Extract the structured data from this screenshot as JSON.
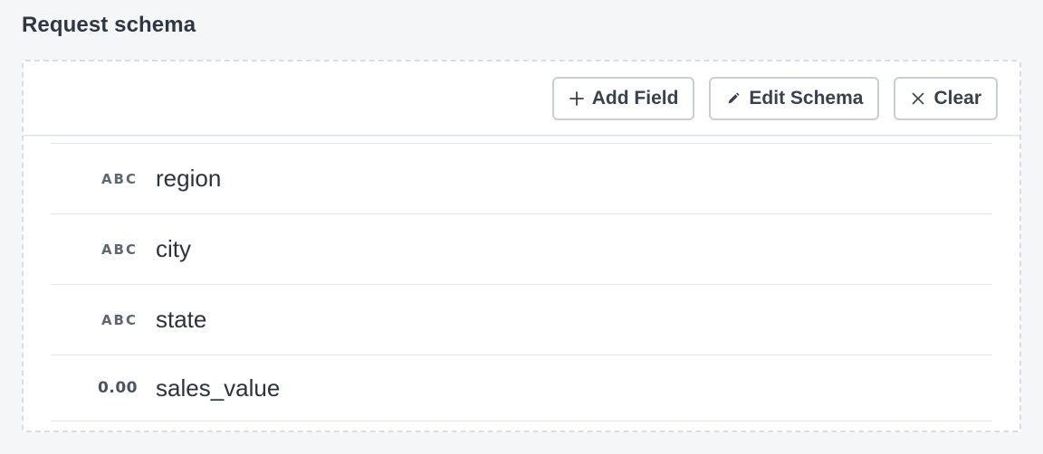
{
  "section": {
    "title": "Request schema"
  },
  "toolbar": {
    "add_field": {
      "label": "Add Field",
      "icon": "plus-icon"
    },
    "edit_schema": {
      "label": "Edit Schema",
      "icon": "pencil-icon"
    },
    "clear": {
      "label": "Clear",
      "icon": "close-icon"
    }
  },
  "fields": [
    {
      "type": "ABC",
      "name": "region"
    },
    {
      "type": "ABC",
      "name": "city"
    },
    {
      "type": "ABC",
      "name": "state"
    },
    {
      "type": "0.00",
      "name": "sales_value"
    }
  ],
  "colors": {
    "background": "#f5f6f8",
    "panel_border": "#d9dde3",
    "text_primary": "#2f3742",
    "type_badge": "#5e6673"
  }
}
